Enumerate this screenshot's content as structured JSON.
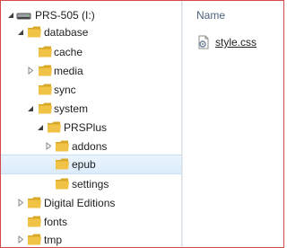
{
  "tree": {
    "drive_label": "PRS-505 (I:)",
    "items": [
      {
        "label": "database",
        "expanded": true
      },
      {
        "label": "cache",
        "expanded": null
      },
      {
        "label": "media",
        "expanded": false
      },
      {
        "label": "sync",
        "expanded": null
      },
      {
        "label": "system",
        "expanded": true
      },
      {
        "label": "PRSPlus",
        "expanded": true
      },
      {
        "label": "addons",
        "expanded": false
      },
      {
        "label": "epub",
        "expanded": null,
        "selected": true
      },
      {
        "label": "settings",
        "expanded": null
      },
      {
        "label": "Digital Editions",
        "expanded": false
      },
      {
        "label": "fonts",
        "expanded": null
      },
      {
        "label": "tmp",
        "expanded": false
      }
    ]
  },
  "content": {
    "column_name": "Name",
    "files": [
      {
        "name": "style.css",
        "icon": "css-file-icon"
      }
    ]
  },
  "colors": {
    "folder": "#f0c246",
    "folder_dark": "#d9a826",
    "selection": "#dcecfc",
    "header_text": "#4c607a"
  }
}
